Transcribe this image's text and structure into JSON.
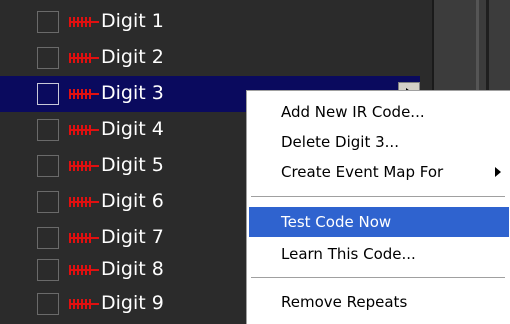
{
  "list": {
    "items": [
      {
        "label": "Digit 1",
        "selected": false
      },
      {
        "label": "Digit 2",
        "selected": false
      },
      {
        "label": "Digit 3",
        "selected": true
      },
      {
        "label": "Digit 4",
        "selected": false
      },
      {
        "label": "Digit 5",
        "selected": false
      },
      {
        "label": "Digit 6",
        "selected": false
      },
      {
        "label": "Digit 7",
        "selected": false
      },
      {
        "label": "Digit 8",
        "selected": false
      },
      {
        "label": "Digit 9",
        "selected": false
      }
    ],
    "item_icon": "ir-code-icon",
    "row_action_icon": "play-arrow-icon"
  },
  "context_menu": {
    "items": [
      {
        "label": "Add New IR Code...",
        "highlighted": false
      },
      {
        "label": "Delete Digit 3...",
        "highlighted": false
      },
      {
        "label": "Create Event Map For",
        "highlighted": false,
        "submenu_icon": "chevron-right-icon"
      },
      {
        "label": "Test Code Now",
        "highlighted": true
      },
      {
        "label": "Learn This Code...",
        "highlighted": false
      },
      {
        "label": "Remove Repeats",
        "highlighted": false
      }
    ]
  },
  "colors": {
    "list_background": "#2b2b2b",
    "selected_row": "#0a0a5e",
    "menu_highlight": "#2f63cf",
    "ir_icon": "#e01010",
    "text": "#ffffff"
  }
}
